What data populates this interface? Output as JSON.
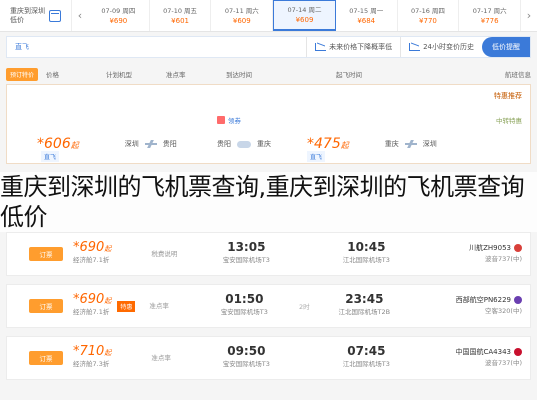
{
  "date_strip": {
    "left_label_line1": "重庆到深圳",
    "left_label_line2": "低价",
    "prev_arrow": "‹",
    "next_arrow": "›",
    "days": [
      {
        "date": "07-09 周四",
        "price": "¥690"
      },
      {
        "date": "07-10 周五",
        "price": "¥601"
      },
      {
        "date": "07-11 周六",
        "price": "¥609"
      },
      {
        "date": "07-14 周二",
        "price": "¥609",
        "active": true
      },
      {
        "date": "07-15 周一",
        "price": "¥684"
      },
      {
        "date": "07-16 周四",
        "price": "¥770"
      },
      {
        "date": "07-17 周六",
        "price": "¥776"
      }
    ]
  },
  "filter_bar": {
    "items": [
      "直飞",
      "起飞时段",
      "机场",
      "航空公司",
      "舱位"
    ],
    "trend_text": "未来价格下降概率低",
    "trend2_text": "24小时变价历史",
    "badge": "低价提醒"
  },
  "header_row": {
    "special_btn": "预订特价",
    "cols": [
      "价格",
      "计划机型",
      "准点率",
      "到达时间",
      "起飞时间",
      "航班信息"
    ]
  },
  "special": {
    "title": "特惠推荐",
    "sub": "中转特惠",
    "gift": "领券",
    "cards": [
      {
        "price": "606",
        "unit": "起",
        "tag": "直飞",
        "from": "贵阳",
        "to": "深圳"
      },
      {
        "price": "475",
        "unit": "起",
        "tag": "直飞",
        "from": "重庆",
        "to": "贵阳"
      }
    ]
  },
  "overlay_text": "重庆到深圳的飞机票查询,重庆到深圳的飞机票查询低价",
  "flights": [
    {
      "btn": "订票",
      "price": "690",
      "unit": "起",
      "sub": "经济舱7.1折",
      "promo": "",
      "tax": "税费说明",
      "arr": "13:05",
      "arr_ap": "宝安国际机场T3",
      "dur": "",
      "dep": "10:45",
      "dep_ap": "江北国际机场T3",
      "air": "川航ZH9053",
      "plane": "波音737(中)"
    },
    {
      "btn": "订票",
      "price": "690",
      "unit": "起",
      "sub": "经济舱7.1折",
      "promo": "特惠",
      "tax": "准点率",
      "arr": "01:50",
      "arr_ap": "宝安国际机场T3",
      "dur": "2时",
      "dep": "23:45",
      "dep_ap": "江北国际机场T2B",
      "air": "西部航空PN6229",
      "plane": "空客320(中)"
    },
    {
      "btn": "订票",
      "price": "710",
      "unit": "起",
      "sub": "经济舱7.3折",
      "promo": "",
      "tax": "准点率",
      "arr": "09:50",
      "arr_ap": "宝安国际机场T3",
      "dur": "",
      "dep": "07:45",
      "dep_ap": "江北国际机场T3",
      "air": "中国国航CA4343",
      "plane": "波音737(中)"
    }
  ],
  "colors": {
    "accent": "#3b7ad9",
    "price": "#ff6600",
    "button": "#ff9d2e"
  }
}
